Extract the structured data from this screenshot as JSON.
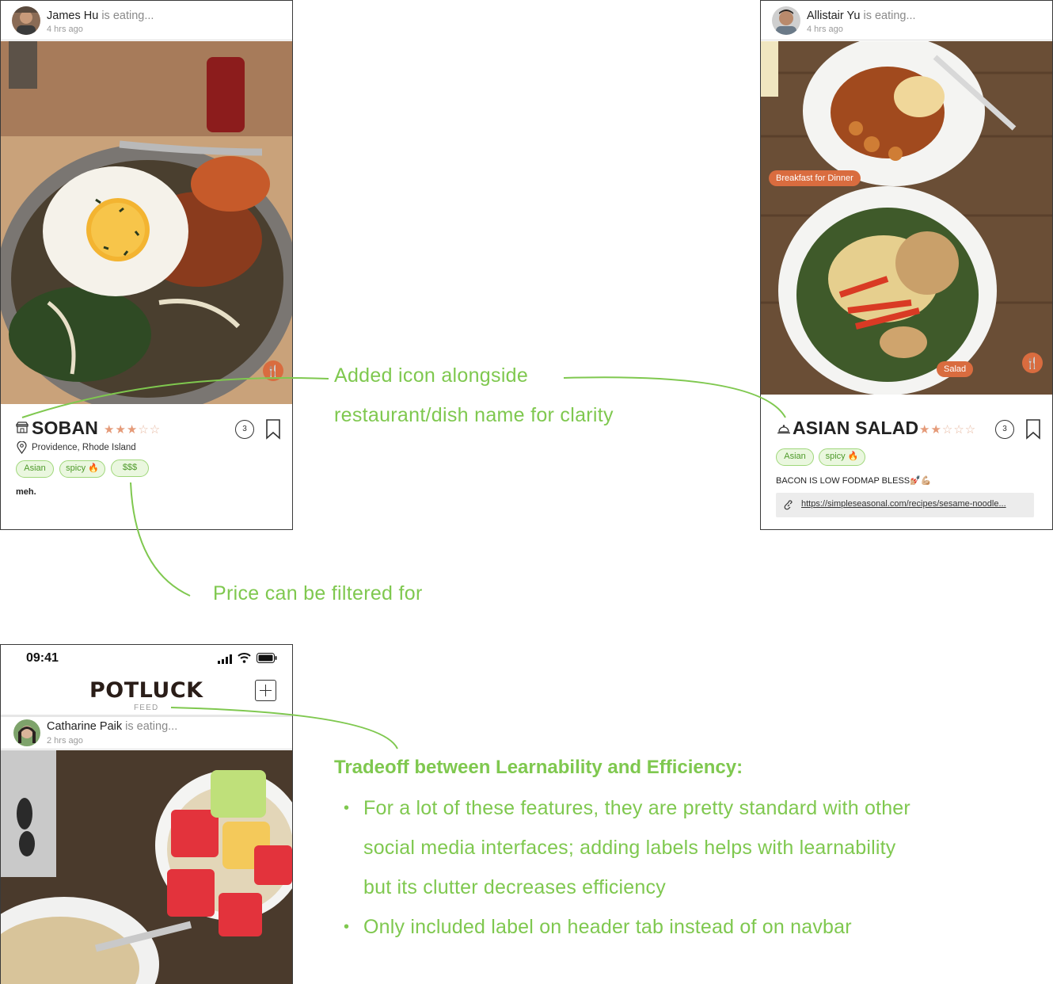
{
  "colors": {
    "accent_green": "#7fc84f",
    "food_orange": "#d96c3f",
    "star": "#e59a78"
  },
  "post1": {
    "user": "James Hu",
    "action": "is eating...",
    "time": "4 hrs ago",
    "title": "SOBAN",
    "title_icon": "restaurant-icon",
    "rating": 3,
    "location": "Providence, Rhode Island",
    "tags": [
      "Asian",
      "spicy 🔥",
      "$$$"
    ],
    "comment_count": "3",
    "note": "meh."
  },
  "post2": {
    "user": "Allistair Yu",
    "action": "is eating...",
    "time": "4 hrs ago",
    "title": "ASIAN SALAD",
    "title_icon": "dish-cloche-icon",
    "rating": 2,
    "tags": [
      "Asian",
      "spicy 🔥"
    ],
    "food_tags": [
      "Breakfast for Dinner",
      "Salad"
    ],
    "comment_count": "3",
    "note": "BACON IS LOW FODMAP BLESS💅🏼💪🏼",
    "link": "https://simpleseasonal.com/recipes/sesame-noodle..."
  },
  "phone": {
    "status_time": "09:41",
    "app_name": "POTLUCK",
    "tab_label": "FEED",
    "post": {
      "user": "Catharine Paik",
      "action": "is eating...",
      "time": "2 hrs ago"
    }
  },
  "annotations": {
    "icon_note_line1": "Added icon alongside",
    "icon_note_line2": "restaurant/dish name for clarity",
    "price_note": "Price can be filtered for",
    "tradeoff_title": "Tradeoff between Learnability and Efficiency:",
    "bullets": [
      "For a lot of these features, they are pretty standard with other",
      "social media interfaces; adding labels helps with learnability",
      "but its clutter decreases efficiency",
      "Only included label on header tab instead of on navbar"
    ]
  }
}
